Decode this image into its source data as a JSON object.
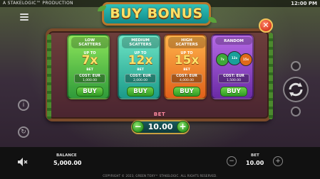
{
  "topbar": {
    "brand": "A STAKELOGIC™ PRODUCTION",
    "clock": "12:00 PM"
  },
  "dialog": {
    "title": "BUY BONUS",
    "close_symbol": "✕",
    "options": [
      {
        "name_line1": "LOW",
        "name_line2": "SCATTERS",
        "upto": "UP TO",
        "multiplier": "7x",
        "bet_label": "BET",
        "cost_label": "COST: EUR",
        "cost_value": "1,000.00",
        "buy_label": "BUY",
        "color_top": "#8de65a",
        "color_bottom": "#2f9a3a"
      },
      {
        "name_line1": "MEDIUM",
        "name_line2": "SCATTERS",
        "upto": "UP TO",
        "multiplier": "12x",
        "bet_label": "BET",
        "cost_label": "COST: EUR",
        "cost_value": "2,000.00",
        "buy_label": "BUY",
        "color_top": "#6fe6c6",
        "color_bottom": "#1b9a8a"
      },
      {
        "name_line1": "HIGH",
        "name_line2": "SCATTERS",
        "upto": "UP TO",
        "multiplier": "15x",
        "bet_label": "BET",
        "cost_label": "COST: EUR",
        "cost_value": "4,000.00",
        "buy_label": "BUY",
        "color_top": "#ffb34a",
        "color_bottom": "#e0601a"
      },
      {
        "name_line1": "RANDOM",
        "name_line2": "",
        "cost_label": "COST: EUR",
        "cost_value": "1,500.00",
        "buy_label": "BUY",
        "color_top": "#b66ae6",
        "color_bottom": "#6a2aa5",
        "orbs": [
          "7x",
          "12x",
          "15x"
        ]
      }
    ],
    "bet": {
      "title": "BET",
      "value": "10.00",
      "minus_symbol": "−",
      "plus_symbol": "+"
    }
  },
  "bottombar": {
    "balance_label": "BALANCE",
    "balance_value": "5,000.00",
    "bet_label": "BET",
    "bet_value": "10.00",
    "minus_symbol": "−",
    "plus_symbol": "+"
  },
  "copyright": "COPYRIGHT © 2023, GREEN TOXY™ STAKELOGIC. ALL RIGHTS RESERVED."
}
